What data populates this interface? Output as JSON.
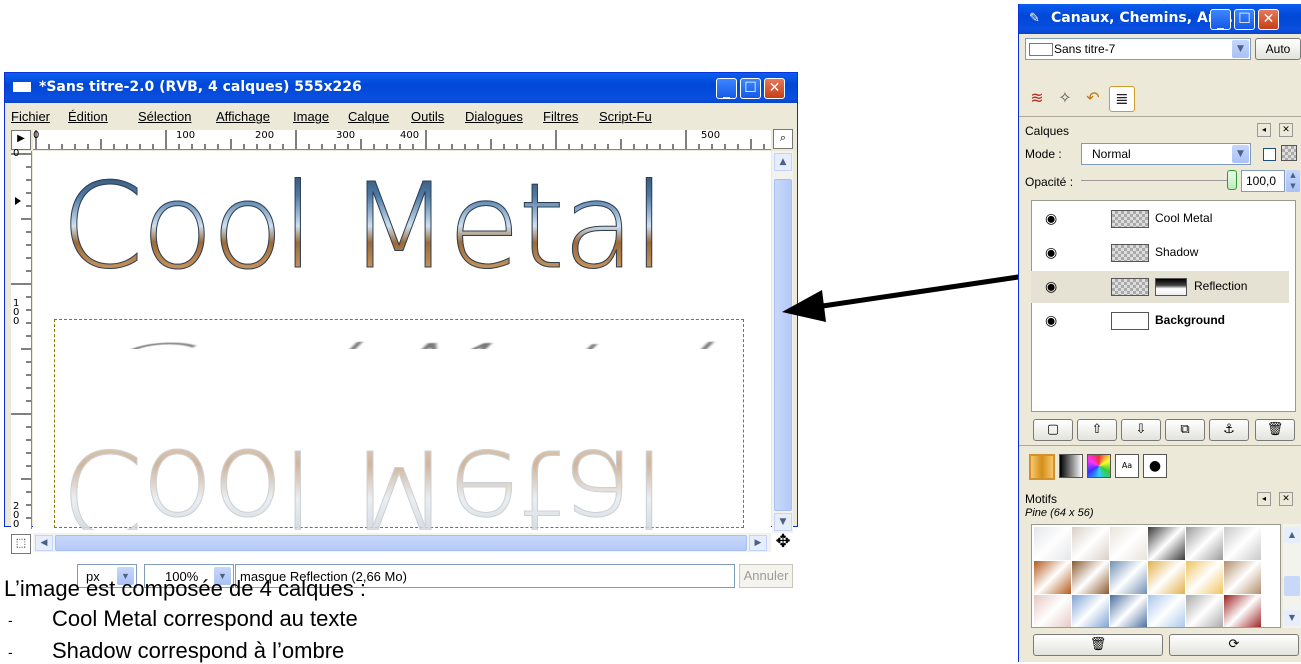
{
  "image_window": {
    "title": "*Sans titre-2.0 (RVB, 4 calques) 555x226",
    "menu": [
      "Fichier",
      "Édition",
      "Sélection",
      "Affichage",
      "Image",
      "Calque",
      "Outils",
      "Dialogues",
      "Filtres",
      "Script-Fu"
    ],
    "ruler_h_labels": [
      "0",
      "100",
      "200",
      "300",
      "400",
      "500"
    ],
    "ruler_v_labels": [
      "0",
      "1\n0\n0",
      "2\n0\n0"
    ],
    "canvas_text": "Cool Metal",
    "status": {
      "unit": "px",
      "zoom": "100%",
      "message": "masque Reflection (2,66 Mo)",
      "cancel_label": "Annuler"
    }
  },
  "panel": {
    "title": "Canaux, Chemins, Ann...",
    "image_select": "Sans titre-7",
    "auto_label": "Auto",
    "layers_header": "Calques",
    "mode_label": "Mode :",
    "mode_value": "Normal",
    "opacity_label": "Opacité :",
    "opacity_value": "100,0",
    "layers": [
      {
        "name": "Cool Metal",
        "bold": false
      },
      {
        "name": "Shadow",
        "bold": false
      },
      {
        "name": "Reflection",
        "bold": false
      },
      {
        "name": "Background",
        "bold": true
      }
    ],
    "patterns_header": "Motifs",
    "pattern_name": "Pine (64 x 56)"
  },
  "caption": {
    "intro": "L’image est composée de 4 calques :",
    "bullets": [
      "Cool Metal correspond au texte",
      "Shadow correspond à l’ombre"
    ]
  },
  "colors": {
    "xp_blue": "#0a5ef0",
    "panel_bg": "#ece9d8",
    "selected_row": "#e6e2d3"
  }
}
